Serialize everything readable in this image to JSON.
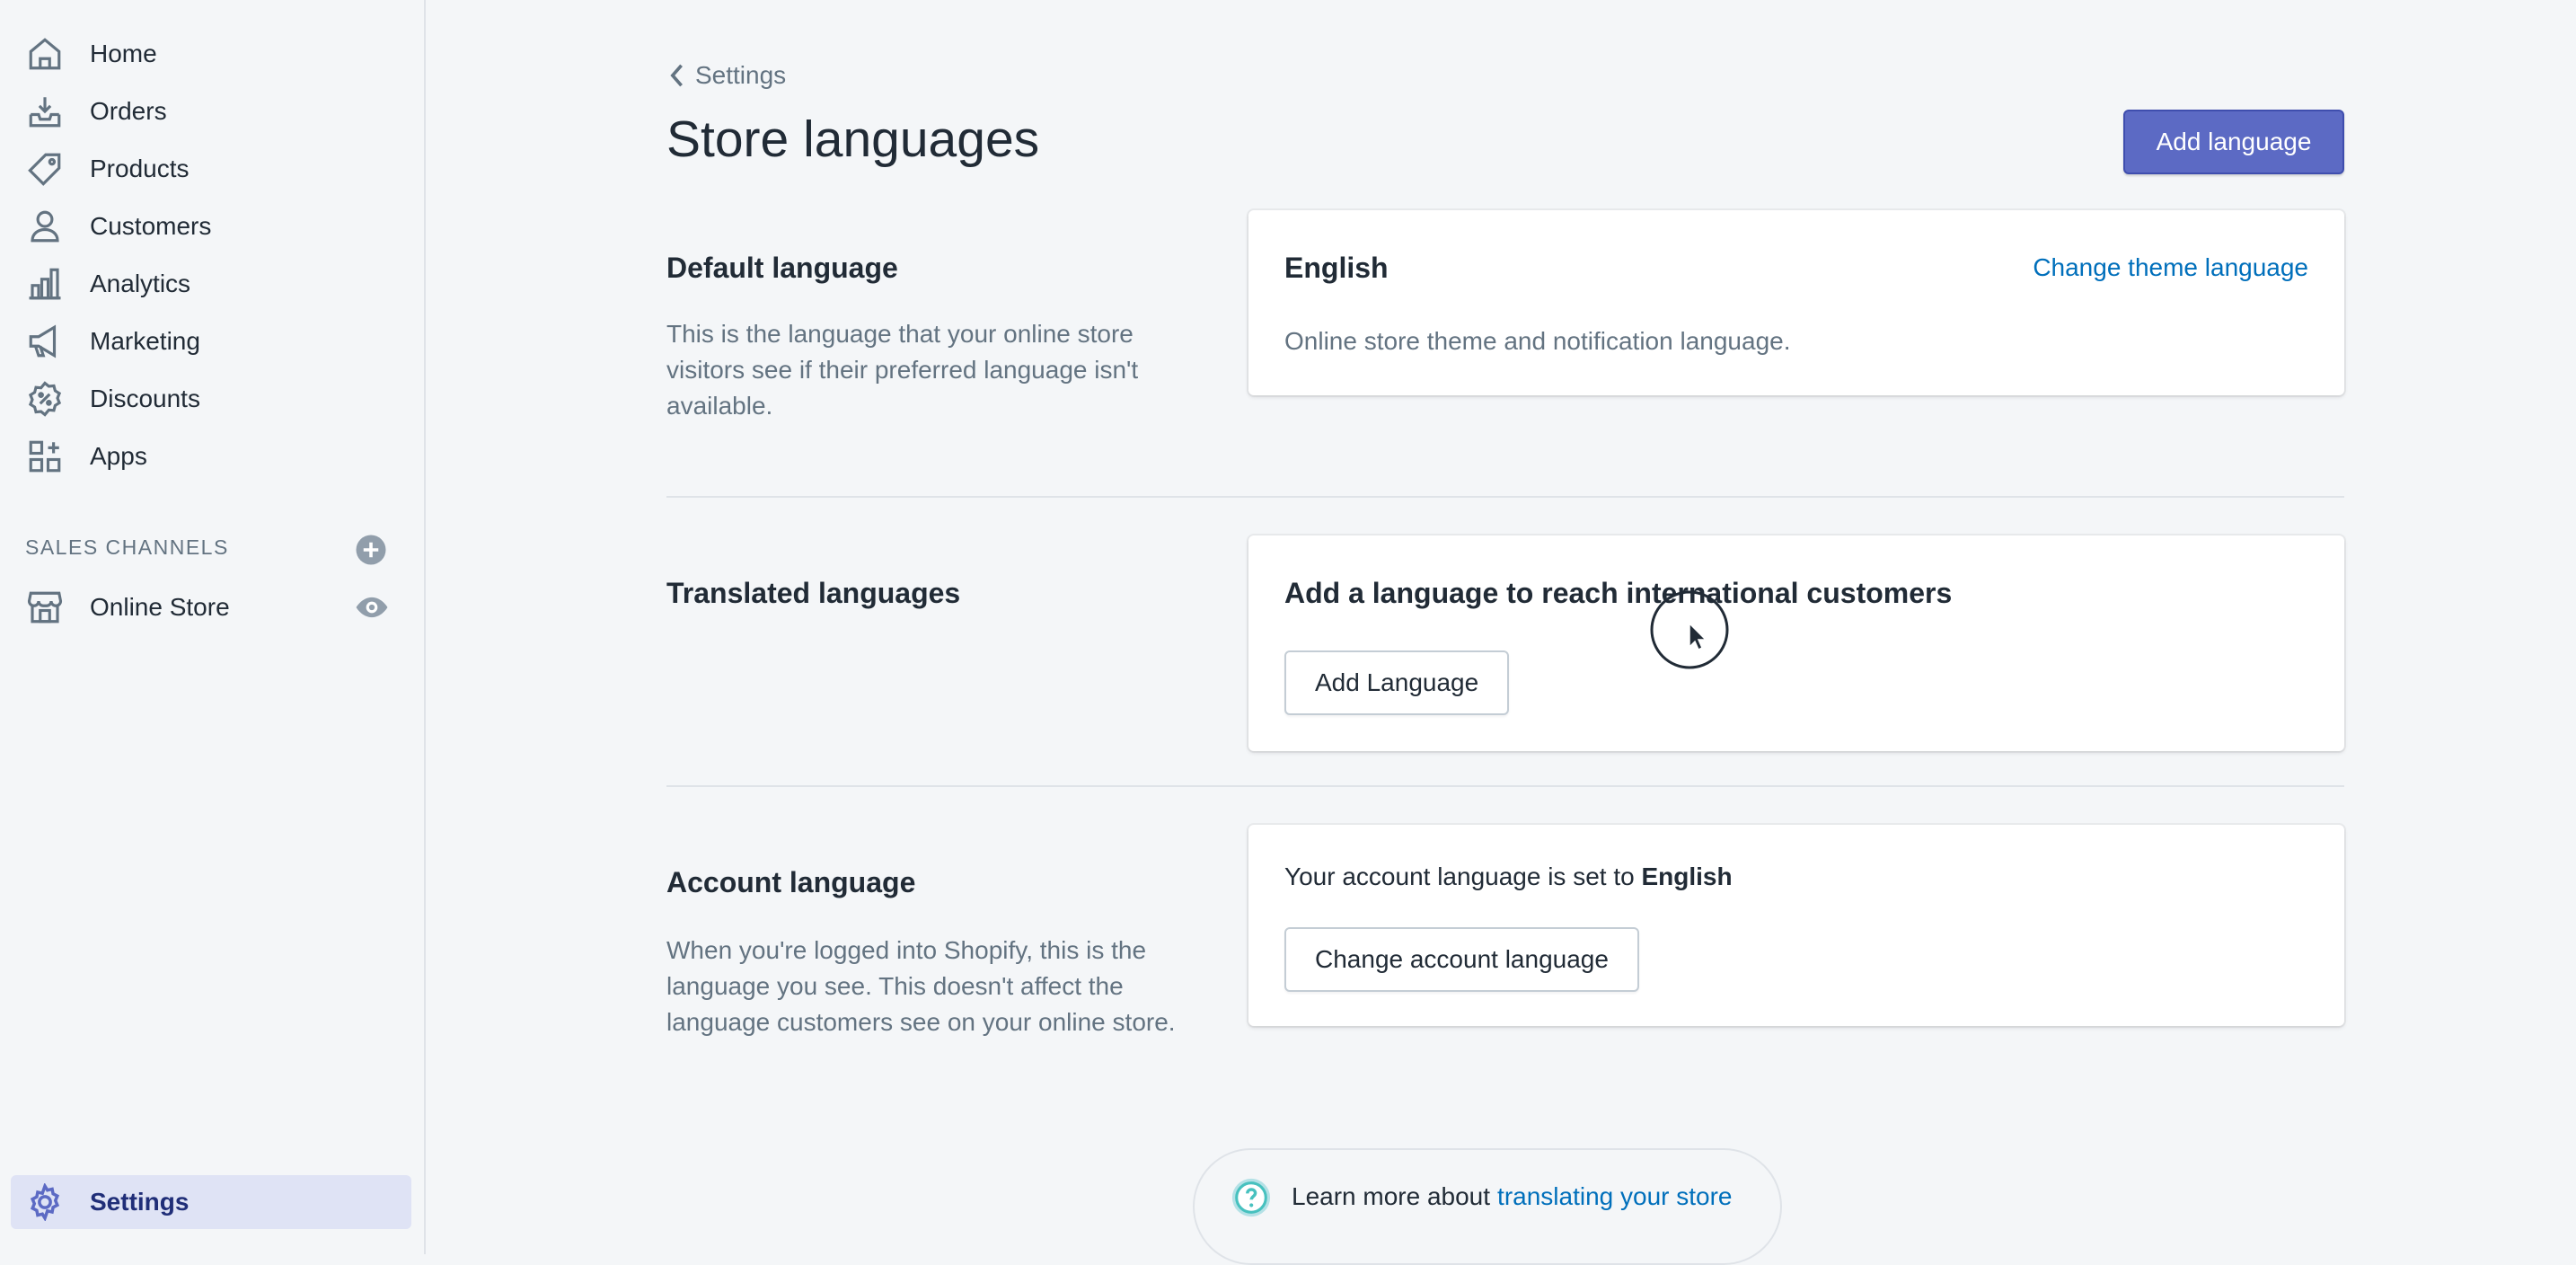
{
  "sidebar": {
    "items": [
      {
        "name": "home",
        "label": "Home",
        "icon": "home-icon"
      },
      {
        "name": "orders",
        "label": "Orders",
        "icon": "orders-icon"
      },
      {
        "name": "products",
        "label": "Products",
        "icon": "tag-icon"
      },
      {
        "name": "customers",
        "label": "Customers",
        "icon": "person-icon"
      },
      {
        "name": "analytics",
        "label": "Analytics",
        "icon": "bar-chart-icon"
      },
      {
        "name": "marketing",
        "label": "Marketing",
        "icon": "megaphone-icon"
      },
      {
        "name": "discounts",
        "label": "Discounts",
        "icon": "discount-badge-icon"
      },
      {
        "name": "apps",
        "label": "Apps",
        "icon": "apps-grid-icon"
      }
    ],
    "sales_channels_heading": "SALES CHANNELS",
    "online_store_label": "Online Store",
    "settings_label": "Settings"
  },
  "header": {
    "breadcrumb": "Settings",
    "title": "Store languages",
    "add_language_label": "Add language"
  },
  "default_language": {
    "title": "Default language",
    "description": "This is the language that your online store visitors see if their preferred language isn't available.",
    "card_language": "English",
    "change_link": "Change theme language",
    "card_text": "Online store theme and notification language."
  },
  "translated_languages": {
    "title": "Translated languages",
    "card_heading": "Add a language to reach international customers",
    "button_label": "Add Language"
  },
  "account_language": {
    "title": "Account language",
    "description": "When you're logged into Shopify, this is the language you see. This doesn't affect the language customers see on your online store.",
    "card_text_prefix": "Your account language is set to",
    "card_text_language": "English",
    "button_label": "Change account language"
  },
  "help": {
    "text": "Learn more about",
    "link": "translating your store"
  },
  "colors": {
    "primary": "#5c6ac4",
    "link": "#006fbb",
    "active_nav": "#202e78"
  }
}
